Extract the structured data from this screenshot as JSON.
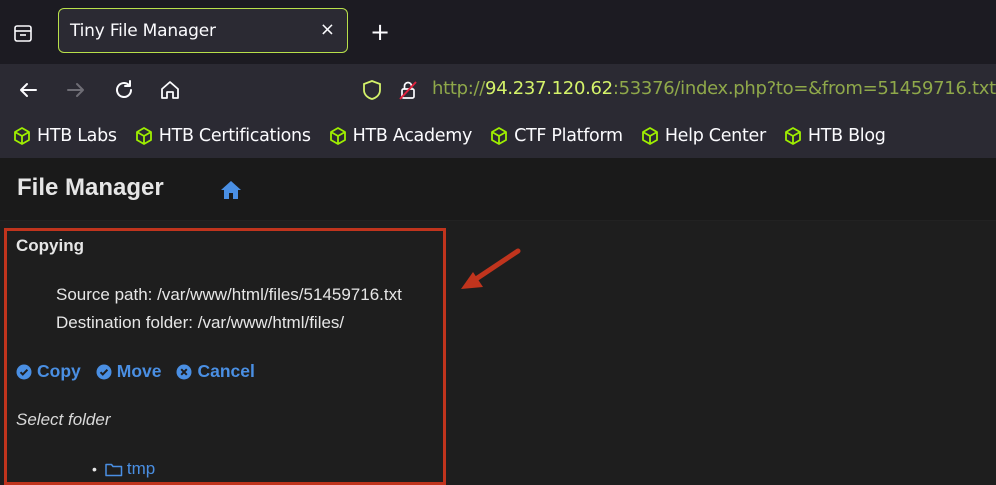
{
  "browser": {
    "tab": {
      "title": "Tiny File Manager",
      "close": "×"
    },
    "new_tab": "+",
    "url": {
      "prefix": "http://",
      "host": "94.237.120.62",
      "rest": ":53376/index.php?to=&from=51459716.txt"
    },
    "bookmarks": [
      {
        "label": "HTB Labs",
        "icon": "htb-cube-icon"
      },
      {
        "label": "HTB Certifications",
        "icon": "htb-cube-icon"
      },
      {
        "label": "HTB Academy",
        "icon": "htb-cube-icon"
      },
      {
        "label": "CTF Platform",
        "icon": "htb-cube-icon"
      },
      {
        "label": "Help Center",
        "icon": "htb-cube-icon"
      },
      {
        "label": "HTB Blog",
        "icon": "htb-cube-icon"
      }
    ]
  },
  "app": {
    "title": "File Manager",
    "copy_panel": {
      "heading": "Copying",
      "source_path": "Source path: /var/www/html/files/51459716.txt",
      "destination_folder": "Destination folder: /var/www/html/files/",
      "actions": {
        "copy": "Copy",
        "move": "Move",
        "cancel": "Cancel"
      },
      "select_folder": "Select folder",
      "folders": [
        {
          "name": "tmp"
        }
      ]
    }
  },
  "colors": {
    "accent_link": "#4a8fe3",
    "tab_border": "#b8e04a",
    "url_host": "#d4f26a",
    "annotation": "#c0341d",
    "bookmark_icon": "#9fef00"
  }
}
